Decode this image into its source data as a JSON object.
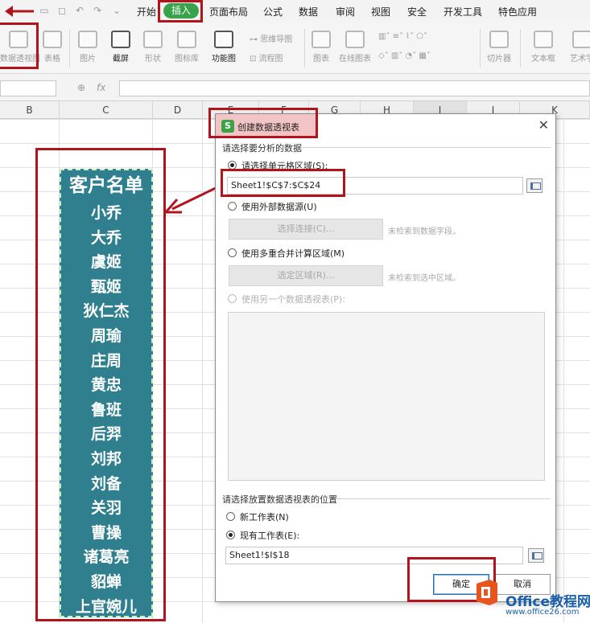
{
  "menubar": {
    "tabs": [
      "开始",
      "插入",
      "页面布局",
      "公式",
      "数据",
      "审阅",
      "视图",
      "安全",
      "开发工具",
      "特色应用"
    ],
    "active_tab": "插入"
  },
  "ribbon": {
    "pivot_table": "数据透视图",
    "table": "表格",
    "picture": "图片",
    "screenshot": "截屏",
    "shape": "形状",
    "icon_lib": "图标库",
    "function_chart": "功能图",
    "mindmap": "思维导图",
    "flowchart": "流程图",
    "chart": "图表",
    "online_chart": "在线图表",
    "slicer": "切片器",
    "textbox": "文本框",
    "art_text": "艺术字"
  },
  "columns": [
    "B",
    "C",
    "D",
    "E",
    "F",
    "G",
    "H",
    "I",
    "J",
    "K"
  ],
  "customer_list": {
    "title": "客户名单",
    "names": [
      "小乔",
      "大乔",
      "虞姬",
      "甄姬",
      "狄仁杰",
      "周瑜",
      "庄周",
      "黄忠",
      "鲁班",
      "后羿",
      "刘邦",
      "刘备",
      "关羽",
      "曹操",
      "诸葛亮",
      "貂蝉",
      "上官婉儿"
    ]
  },
  "dialog": {
    "title": "创建数据透视表",
    "section_source": "请选择要分析的数据",
    "opt_cell_range": "请选择单元格区域(S):",
    "cell_range_value": "Sheet1!$C$7:$C$24",
    "opt_external": "使用外部数据源(U)",
    "btn_select_connection": "选择连接(C)...",
    "hint_no_fields": "未检索到数据字段。",
    "opt_multi_consolidate": "使用多重合并计算区域(M)",
    "btn_select_region": "选定区域(R)...",
    "hint_no_region": "未检索到选中区域。",
    "opt_other_pivot": "使用另一个数据透视表(P):",
    "section_location": "请选择放置数据透视表的位置",
    "opt_new_sheet": "新工作表(N)",
    "opt_existing_sheet": "现有工作表(E):",
    "location_value": "Sheet1!$I$18",
    "btn_ok": "确定",
    "btn_cancel": "取消"
  },
  "watermark": {
    "brand": "Office教程网",
    "url": "www.office26.com"
  },
  "colors": {
    "list_bg": "#2f7f8f",
    "highlight_red": "#b2141d",
    "active_tab_green": "#38a34a"
  }
}
